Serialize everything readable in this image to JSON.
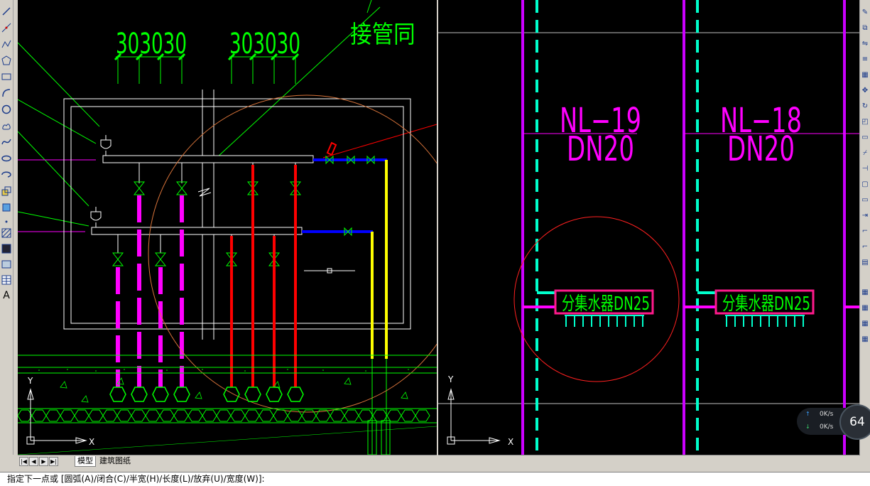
{
  "viewport_left": {
    "annotation_partial": "接管同",
    "dim_group_left": "303030",
    "dim_group_right": "303030",
    "ucs_y": "Y",
    "ucs_x": "X"
  },
  "viewport_right": {
    "label_a_top": "NL−19",
    "label_a_bottom": "DN20",
    "label_b_top": "NL−18",
    "label_b_bottom": "DN20",
    "manifold_a": "分集水器DN25",
    "manifold_b": "分集水器DN25",
    "ucs_y": "Y",
    "ucs_x": "X"
  },
  "tabs": {
    "model": "模型",
    "layout": "建筑图纸",
    "nav_first": "|◀",
    "nav_prev": "◀",
    "nav_next": "▶",
    "nav_last": "▶|"
  },
  "command_line": "指定下一点或 [圆弧(A)/闭合(C)/半宽(H)/长度(L)/放弃(U)/宽度(W)]:",
  "left_toolbar": {
    "text_tool": "A"
  },
  "net_monitor": {
    "upload": "0K/s",
    "download": "0K/s",
    "cpu": "64",
    "up_icon": "↑",
    "down_icon": "↓"
  },
  "colors": {
    "cad_bg": "#000000",
    "cad_green": "#00ff00",
    "cad_magenta": "#ff00ff",
    "cad_red": "#ff0000",
    "cad_yellow": "#ffff00",
    "cad_blue": "#0000ff",
    "cad_cyan": "#00ffcc"
  }
}
